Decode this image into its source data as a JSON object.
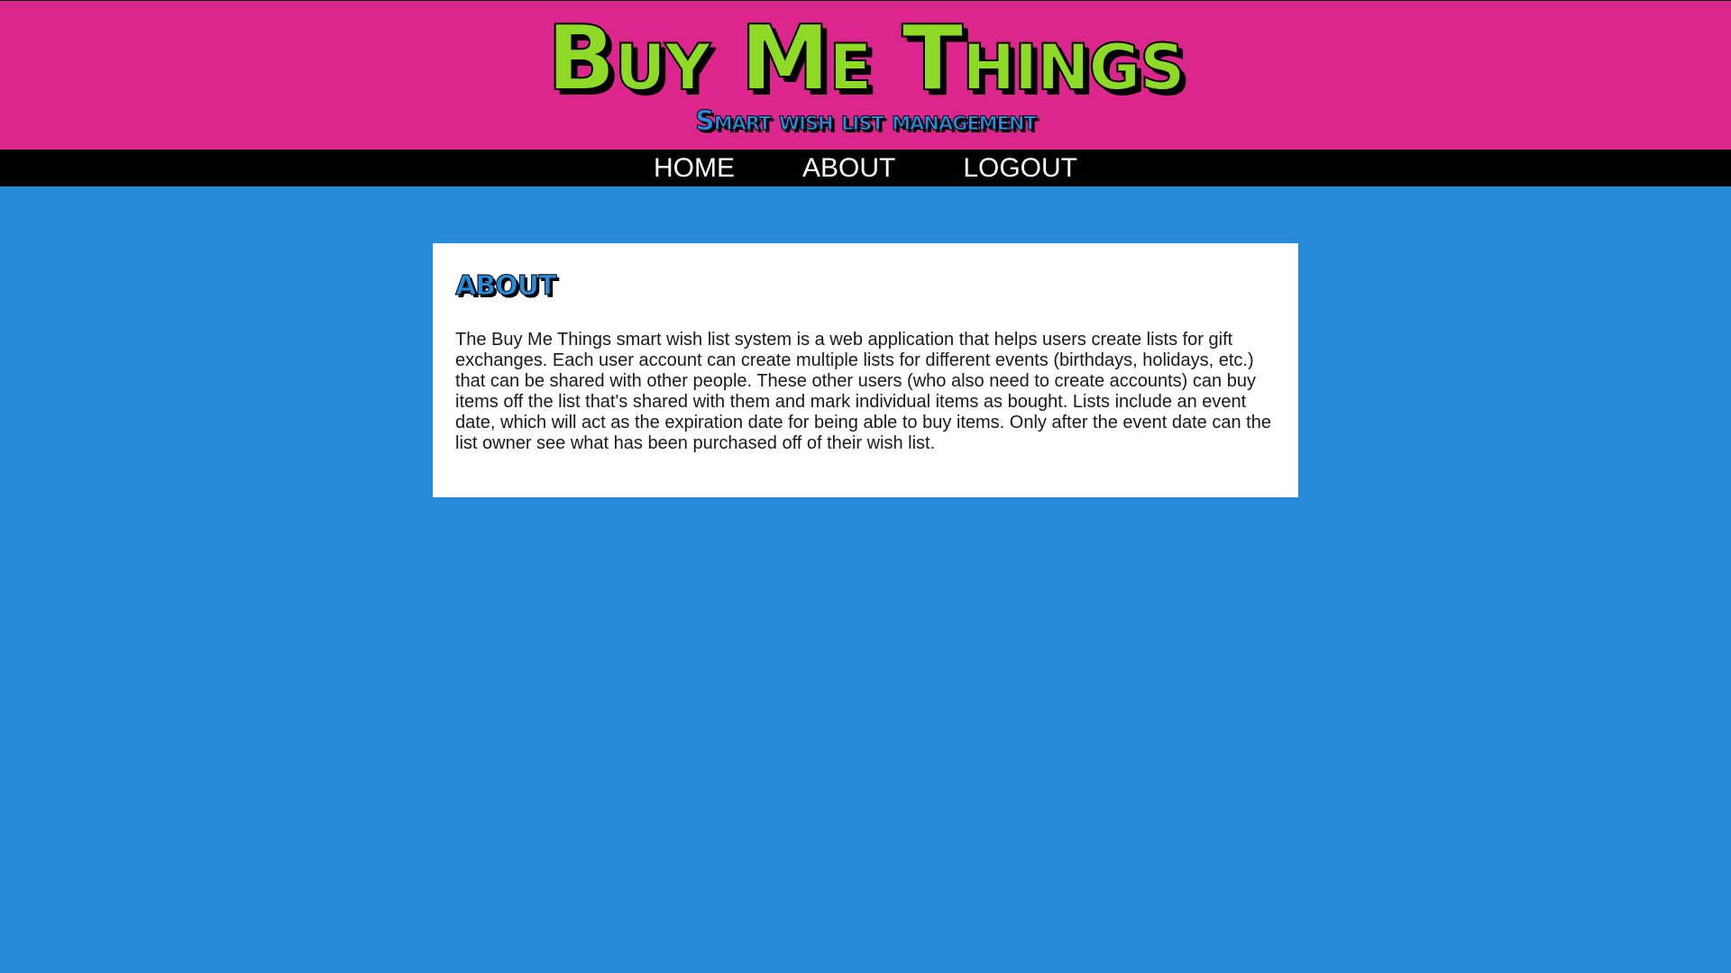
{
  "header": {
    "title": "Buy Me Things",
    "tagline": "Smart wish list management"
  },
  "nav": {
    "items": [
      {
        "label": "HOME"
      },
      {
        "label": "ABOUT"
      },
      {
        "label": "LOGOUT"
      }
    ]
  },
  "about": {
    "heading": "ABOUT",
    "body": "The Buy Me Things smart wish list system is a web application that helps users create lists for gift exchanges. Each user account can create multiple lists for different events (birthdays, holidays, etc.) that can be shared with other people. These other users (who also need to create accounts) can buy items off the list that's shared with them and mark individual items as bought. Lists include an event date, which will act as the expiration date for being able to buy items. Only after the event date can the list owner see what has been purchased off of their wish list."
  },
  "colors": {
    "header_background": "#db268c",
    "title_color": "#8ddb26",
    "page_background": "#268cdb",
    "nav_background": "#000000",
    "card_background": "#ffffff"
  }
}
